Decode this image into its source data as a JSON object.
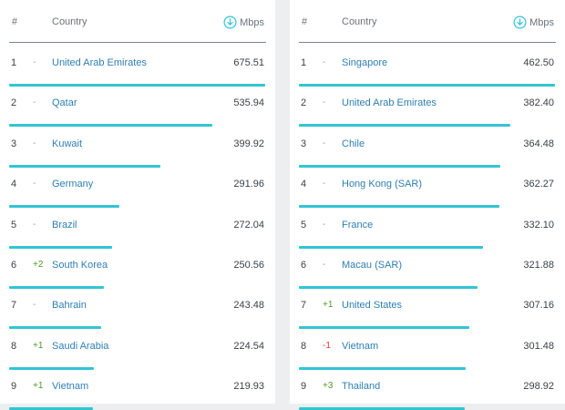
{
  "header": {
    "rank_label": "#",
    "country_label": "Country",
    "speed_label": "Mbps",
    "speed_icon": "download-arrow-icon"
  },
  "colors": {
    "bar": "#31c5d4",
    "country_link": "#2e7fb3",
    "rank_up": "#4e9a2a",
    "rank_down": "#d83b2f"
  },
  "left": {
    "rows": [
      {
        "rank": "1",
        "change": "-",
        "country": "United Arab Emirates",
        "speed": "675.51",
        "bar_fraction": 1.0
      },
      {
        "rank": "2",
        "change": "-",
        "country": "Qatar",
        "speed": "535.94",
        "bar_fraction": 0.793
      },
      {
        "rank": "3",
        "change": "-",
        "country": "Kuwait",
        "speed": "399.92",
        "bar_fraction": 0.592
      },
      {
        "rank": "4",
        "change": "-",
        "country": "Germany",
        "speed": "291.96",
        "bar_fraction": 0.432
      },
      {
        "rank": "5",
        "change": "-",
        "country": "Brazil",
        "speed": "272.04",
        "bar_fraction": 0.403
      },
      {
        "rank": "6",
        "change": "+2",
        "country": "South Korea",
        "speed": "250.56",
        "bar_fraction": 0.371
      },
      {
        "rank": "7",
        "change": "-",
        "country": "Bahrain",
        "speed": "243.48",
        "bar_fraction": 0.36
      },
      {
        "rank": "8",
        "change": "+1",
        "country": "Saudi Arabia",
        "speed": "224.54",
        "bar_fraction": 0.332
      },
      {
        "rank": "9",
        "change": "+1",
        "country": "Vietnam",
        "speed": "219.93",
        "bar_fraction": 0.326
      }
    ]
  },
  "right": {
    "rows": [
      {
        "rank": "1",
        "change": "-",
        "country": "Singapore",
        "speed": "462.50",
        "bar_fraction": 1.0
      },
      {
        "rank": "2",
        "change": "-",
        "country": "United Arab Emirates",
        "speed": "382.40",
        "bar_fraction": 0.827
      },
      {
        "rank": "3",
        "change": "-",
        "country": "Chile",
        "speed": "364.48",
        "bar_fraction": 0.788
      },
      {
        "rank": "4",
        "change": "-",
        "country": "Hong Kong (SAR)",
        "speed": "362.27",
        "bar_fraction": 0.783
      },
      {
        "rank": "5",
        "change": "-",
        "country": "France",
        "speed": "332.10",
        "bar_fraction": 0.718
      },
      {
        "rank": "6",
        "change": "-",
        "country": "Macau (SAR)",
        "speed": "321.88",
        "bar_fraction": 0.696
      },
      {
        "rank": "7",
        "change": "+1",
        "country": "United States",
        "speed": "307.16",
        "bar_fraction": 0.664
      },
      {
        "rank": "8",
        "change": "-1",
        "country": "Vietnam",
        "speed": "301.48",
        "bar_fraction": 0.652
      },
      {
        "rank": "9",
        "change": "+3",
        "country": "Thailand",
        "speed": "298.92",
        "bar_fraction": 0.646
      }
    ]
  }
}
